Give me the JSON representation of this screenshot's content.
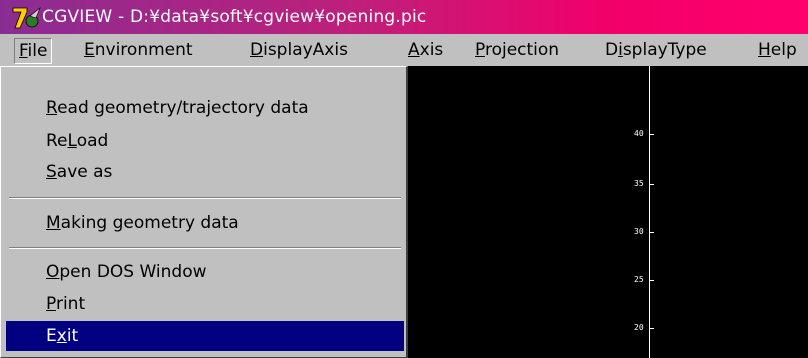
{
  "window": {
    "title": "CGVIEW - D:¥data¥soft¥cgview¥opening.pic"
  },
  "menubar": {
    "items": [
      {
        "label": "File",
        "mnemonic": "F",
        "rest": "ile"
      },
      {
        "label": "Environment",
        "mnemonic": "E",
        "rest": "nvironment"
      },
      {
        "label": "DisplayAxis",
        "mnemonic": "D",
        "rest": "isplayAxis"
      },
      {
        "label": "Axis",
        "mnemonic": "A",
        "rest": "xis"
      },
      {
        "label": "Projection",
        "mnemonic": "P",
        "rest": "rojection"
      },
      {
        "label": "DisplayType",
        "pre": "D",
        "mnemonic": "i",
        "rest": "splayType"
      },
      {
        "label": "Help",
        "mnemonic": "H",
        "rest": "elp"
      }
    ],
    "active": "File"
  },
  "file_menu": {
    "items": [
      {
        "label": "Read geometry/trajectory data",
        "mnemonic": "R",
        "rest": "ead geometry/trajectory data"
      },
      {
        "label": "ReLoad",
        "pre": "Re",
        "mnemonic": "L",
        "rest": "oad"
      },
      {
        "label": "Save as",
        "mnemonic": "S",
        "rest": "ave as"
      },
      {
        "label": "Making geometry data",
        "mnemonic": "M",
        "rest": "aking geometry data"
      },
      {
        "label": "Open DOS Window",
        "mnemonic": "O",
        "rest": "pen DOS Window"
      },
      {
        "label": "Print",
        "mnemonic": "P",
        "rest": "rint"
      },
      {
        "label": "Exit",
        "pre": "E",
        "mnemonic": "x",
        "rest": "it"
      }
    ],
    "selected": "Exit"
  },
  "canvas": {
    "axis_tick_labels": [
      "40",
      "35",
      "30",
      "25",
      "20"
    ]
  },
  "colors": {
    "titlebar_start": "#8a2d92",
    "titlebar_end": "#ff006e",
    "menu_bg": "#c0c0c0",
    "selection": "#000080",
    "canvas_bg": "#000000"
  },
  "icons": {
    "app": "app-icon"
  }
}
